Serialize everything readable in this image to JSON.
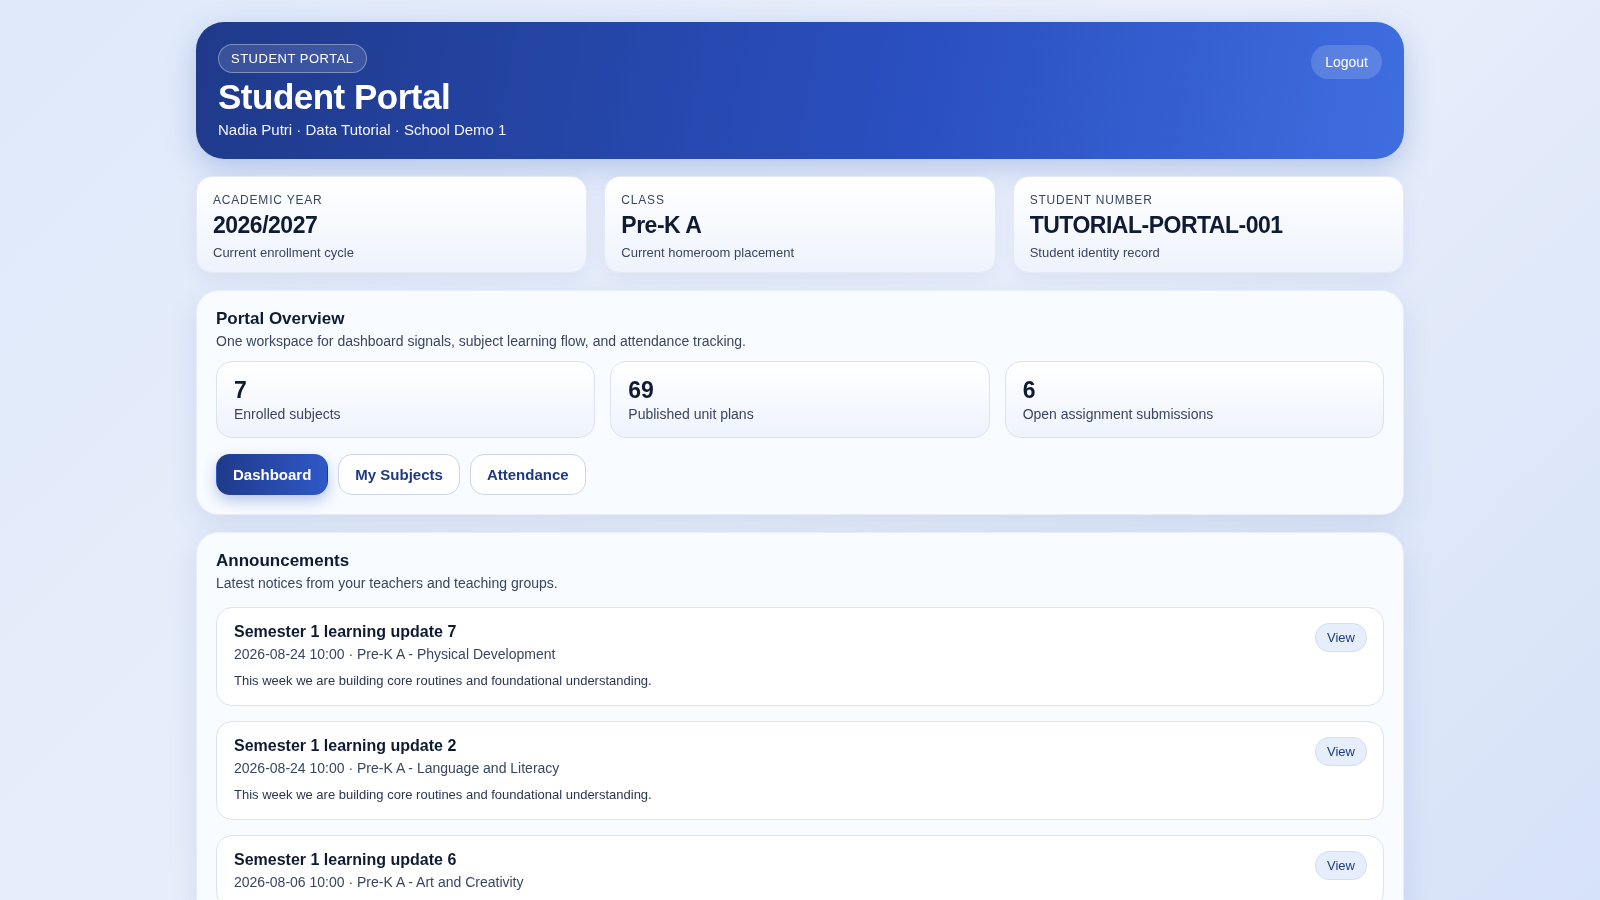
{
  "header": {
    "badge": "STUDENT PORTAL",
    "title": "Student Portal",
    "subtitle": "Nadia Putri · Data Tutorial · School Demo 1",
    "logout": "Logout"
  },
  "info_cards": [
    {
      "label": "ACADEMIC YEAR",
      "value": "2026/2027",
      "caption": "Current enrollment cycle"
    },
    {
      "label": "CLASS",
      "value": "Pre-K A",
      "caption": "Current homeroom placement"
    },
    {
      "label": "STUDENT NUMBER",
      "value": "TUTORIAL-PORTAL-001",
      "caption": "Student identity record"
    }
  ],
  "overview": {
    "title": "Portal Overview",
    "description": "One workspace for dashboard signals, subject learning flow, and attendance tracking.",
    "metrics": [
      {
        "value": "7",
        "label": "Enrolled subjects"
      },
      {
        "value": "69",
        "label": "Published unit plans"
      },
      {
        "value": "6",
        "label": "Open assignment submissions"
      }
    ],
    "tabs": [
      {
        "label": "Dashboard",
        "selected": true
      },
      {
        "label": "My Subjects",
        "selected": false
      },
      {
        "label": "Attendance",
        "selected": false
      }
    ]
  },
  "announcements": {
    "title": "Announcements",
    "description": "Latest notices from your teachers and teaching groups.",
    "items": [
      {
        "title": "Semester 1 learning update 7",
        "meta": "2026-08-24 10:00 · Pre-K A - Physical Development",
        "body": "This week we are building core routines and foundational understanding.",
        "action": "View"
      },
      {
        "title": "Semester 1 learning update 2",
        "meta": "2026-08-24 10:00 · Pre-K A - Language and Literacy",
        "body": "This week we are building core routines and foundational understanding.",
        "action": "View"
      },
      {
        "title": "Semester 1 learning update 6",
        "meta": "2026-08-06 10:00 · Pre-K A - Art and Creativity",
        "action": "View"
      }
    ]
  }
}
